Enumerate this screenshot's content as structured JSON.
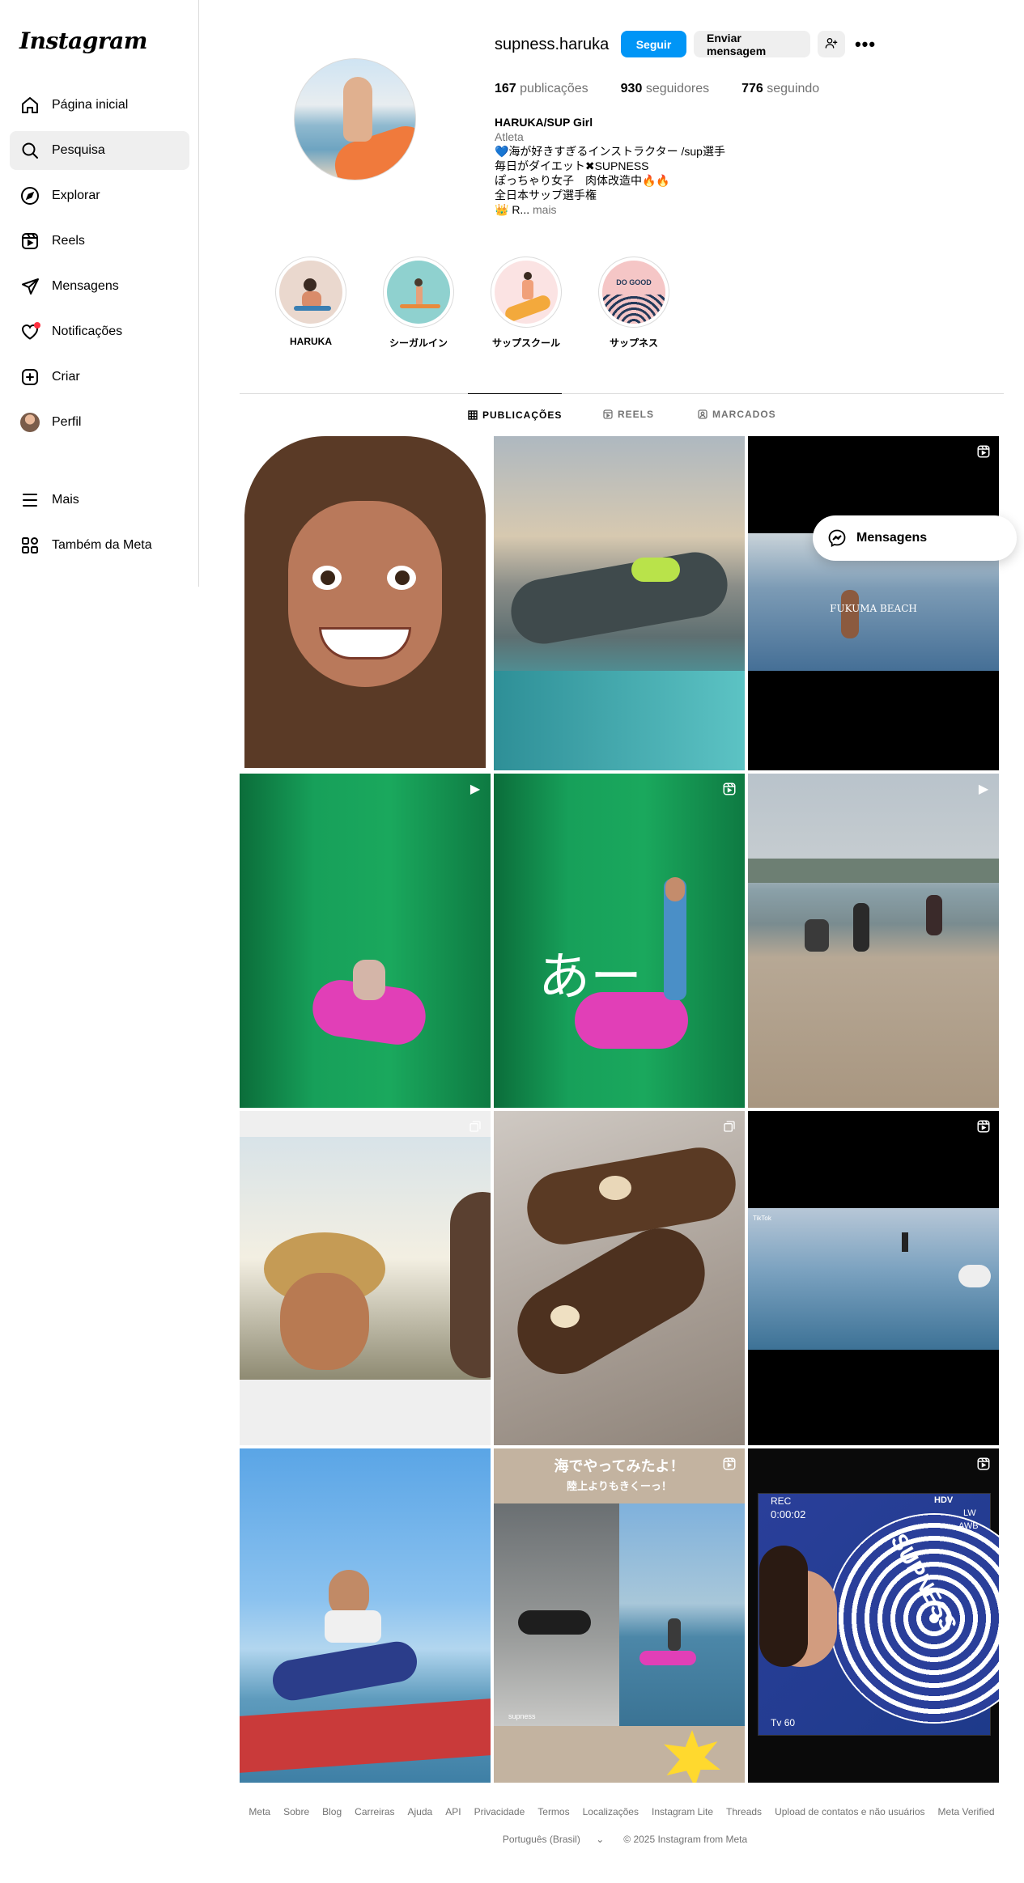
{
  "brand": {
    "logo_text": "Instagram"
  },
  "sidebar": {
    "items": [
      {
        "label": "Página inicial",
        "icon": "home-icon"
      },
      {
        "label": "Pesquisa",
        "icon": "search-icon"
      },
      {
        "label": "Explorar",
        "icon": "compass-icon"
      },
      {
        "label": "Reels",
        "icon": "reels-icon"
      },
      {
        "label": "Mensagens",
        "icon": "direct-icon"
      },
      {
        "label": "Notificações",
        "icon": "heart-icon"
      },
      {
        "label": "Criar",
        "icon": "plus-square-icon"
      },
      {
        "label": "Perfil",
        "icon": "avatar"
      },
      {
        "label": "Mais",
        "icon": "menu-icon"
      },
      {
        "label": "Também da Meta",
        "icon": "meta-apps-icon"
      }
    ]
  },
  "profile": {
    "username": "supness.haruka",
    "follow_label": "Seguir",
    "message_label": "Enviar mensagem",
    "stats": {
      "posts_count": "167",
      "posts_label": "publicações",
      "followers_count": "930",
      "followers_label": "seguidores",
      "following_count": "776",
      "following_label": "seguindo"
    },
    "bio": {
      "name": "HARUKA/SUP Girl",
      "category": "Atleta",
      "line1": "💙海が好きすぎるインストラクター /sup選手",
      "line2": "毎日がダイエット✖︎SUPNESS",
      "line3": "ぽっちゃり女子　肉体改造中🔥🔥",
      "line4": "全日本サップ選手権",
      "line5": "👑 R...",
      "more": "mais"
    }
  },
  "highlights": [
    {
      "label": "HARUKA"
    },
    {
      "label": "シーガルイン"
    },
    {
      "label": "サップスクール"
    },
    {
      "label": "サップネス",
      "text": "DO GOOD"
    }
  ],
  "tabs": [
    {
      "label": "PUBLICAÇÕES",
      "active": true
    },
    {
      "label": "REELS"
    },
    {
      "label": "MARCADOS"
    }
  ],
  "posts": {
    "p3_caption": "FUKUMA BEACH",
    "p5_caption": "あー",
    "p9_watermark": "TikTok",
    "p11_title": "海でやってみたよ！",
    "p11_subtitle": "陸上よりもきくーっ！",
    "p11_watermark": "supness",
    "p12_rec": "REC",
    "p12_time": "0:00:02",
    "p12_hdv": "HDV",
    "p12_lw": "LW",
    "p12_awb": "AWB",
    "p12_tv": "Tv",
    "p12_tv_value": "60",
    "p12_board_text": "SUPNESS"
  },
  "float_messages": {
    "label": "Mensagens"
  },
  "footer": {
    "links": [
      "Meta",
      "Sobre",
      "Blog",
      "Carreiras",
      "Ajuda",
      "API",
      "Privacidade",
      "Termos",
      "Localizações",
      "Instagram Lite",
      "Threads",
      "Upload de contatos e não usuários",
      "Meta Verified"
    ],
    "language": "Português (Brasil)",
    "copyright": "© 2025 Instagram from Meta"
  },
  "colors": {
    "accent": "#0095f6",
    "notification": "#ff3040",
    "muted": "#737373",
    "border": "#dbdbdb"
  }
}
